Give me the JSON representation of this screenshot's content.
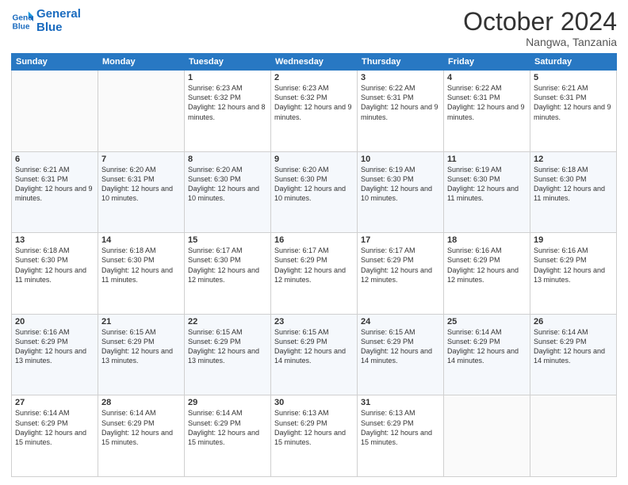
{
  "logo": {
    "line1": "General",
    "line2": "Blue"
  },
  "header": {
    "month": "October 2024",
    "location": "Nangwa, Tanzania"
  },
  "weekdays": [
    "Sunday",
    "Monday",
    "Tuesday",
    "Wednesday",
    "Thursday",
    "Friday",
    "Saturday"
  ],
  "weeks": [
    [
      {
        "day": "",
        "info": ""
      },
      {
        "day": "",
        "info": ""
      },
      {
        "day": "1",
        "info": "Sunrise: 6:23 AM\nSunset: 6:32 PM\nDaylight: 12 hours and 8 minutes."
      },
      {
        "day": "2",
        "info": "Sunrise: 6:23 AM\nSunset: 6:32 PM\nDaylight: 12 hours and 9 minutes."
      },
      {
        "day": "3",
        "info": "Sunrise: 6:22 AM\nSunset: 6:31 PM\nDaylight: 12 hours and 9 minutes."
      },
      {
        "day": "4",
        "info": "Sunrise: 6:22 AM\nSunset: 6:31 PM\nDaylight: 12 hours and 9 minutes."
      },
      {
        "day": "5",
        "info": "Sunrise: 6:21 AM\nSunset: 6:31 PM\nDaylight: 12 hours and 9 minutes."
      }
    ],
    [
      {
        "day": "6",
        "info": "Sunrise: 6:21 AM\nSunset: 6:31 PM\nDaylight: 12 hours and 9 minutes."
      },
      {
        "day": "7",
        "info": "Sunrise: 6:20 AM\nSunset: 6:31 PM\nDaylight: 12 hours and 10 minutes."
      },
      {
        "day": "8",
        "info": "Sunrise: 6:20 AM\nSunset: 6:30 PM\nDaylight: 12 hours and 10 minutes."
      },
      {
        "day": "9",
        "info": "Sunrise: 6:20 AM\nSunset: 6:30 PM\nDaylight: 12 hours and 10 minutes."
      },
      {
        "day": "10",
        "info": "Sunrise: 6:19 AM\nSunset: 6:30 PM\nDaylight: 12 hours and 10 minutes."
      },
      {
        "day": "11",
        "info": "Sunrise: 6:19 AM\nSunset: 6:30 PM\nDaylight: 12 hours and 11 minutes."
      },
      {
        "day": "12",
        "info": "Sunrise: 6:18 AM\nSunset: 6:30 PM\nDaylight: 12 hours and 11 minutes."
      }
    ],
    [
      {
        "day": "13",
        "info": "Sunrise: 6:18 AM\nSunset: 6:30 PM\nDaylight: 12 hours and 11 minutes."
      },
      {
        "day": "14",
        "info": "Sunrise: 6:18 AM\nSunset: 6:30 PM\nDaylight: 12 hours and 11 minutes."
      },
      {
        "day": "15",
        "info": "Sunrise: 6:17 AM\nSunset: 6:30 PM\nDaylight: 12 hours and 12 minutes."
      },
      {
        "day": "16",
        "info": "Sunrise: 6:17 AM\nSunset: 6:29 PM\nDaylight: 12 hours and 12 minutes."
      },
      {
        "day": "17",
        "info": "Sunrise: 6:17 AM\nSunset: 6:29 PM\nDaylight: 12 hours and 12 minutes."
      },
      {
        "day": "18",
        "info": "Sunrise: 6:16 AM\nSunset: 6:29 PM\nDaylight: 12 hours and 12 minutes."
      },
      {
        "day": "19",
        "info": "Sunrise: 6:16 AM\nSunset: 6:29 PM\nDaylight: 12 hours and 13 minutes."
      }
    ],
    [
      {
        "day": "20",
        "info": "Sunrise: 6:16 AM\nSunset: 6:29 PM\nDaylight: 12 hours and 13 minutes."
      },
      {
        "day": "21",
        "info": "Sunrise: 6:15 AM\nSunset: 6:29 PM\nDaylight: 12 hours and 13 minutes."
      },
      {
        "day": "22",
        "info": "Sunrise: 6:15 AM\nSunset: 6:29 PM\nDaylight: 12 hours and 13 minutes."
      },
      {
        "day": "23",
        "info": "Sunrise: 6:15 AM\nSunset: 6:29 PM\nDaylight: 12 hours and 14 minutes."
      },
      {
        "day": "24",
        "info": "Sunrise: 6:15 AM\nSunset: 6:29 PM\nDaylight: 12 hours and 14 minutes."
      },
      {
        "day": "25",
        "info": "Sunrise: 6:14 AM\nSunset: 6:29 PM\nDaylight: 12 hours and 14 minutes."
      },
      {
        "day": "26",
        "info": "Sunrise: 6:14 AM\nSunset: 6:29 PM\nDaylight: 12 hours and 14 minutes."
      }
    ],
    [
      {
        "day": "27",
        "info": "Sunrise: 6:14 AM\nSunset: 6:29 PM\nDaylight: 12 hours and 15 minutes."
      },
      {
        "day": "28",
        "info": "Sunrise: 6:14 AM\nSunset: 6:29 PM\nDaylight: 12 hours and 15 minutes."
      },
      {
        "day": "29",
        "info": "Sunrise: 6:14 AM\nSunset: 6:29 PM\nDaylight: 12 hours and 15 minutes."
      },
      {
        "day": "30",
        "info": "Sunrise: 6:13 AM\nSunset: 6:29 PM\nDaylight: 12 hours and 15 minutes."
      },
      {
        "day": "31",
        "info": "Sunrise: 6:13 AM\nSunset: 6:29 PM\nDaylight: 12 hours and 15 minutes."
      },
      {
        "day": "",
        "info": ""
      },
      {
        "day": "",
        "info": ""
      }
    ]
  ]
}
